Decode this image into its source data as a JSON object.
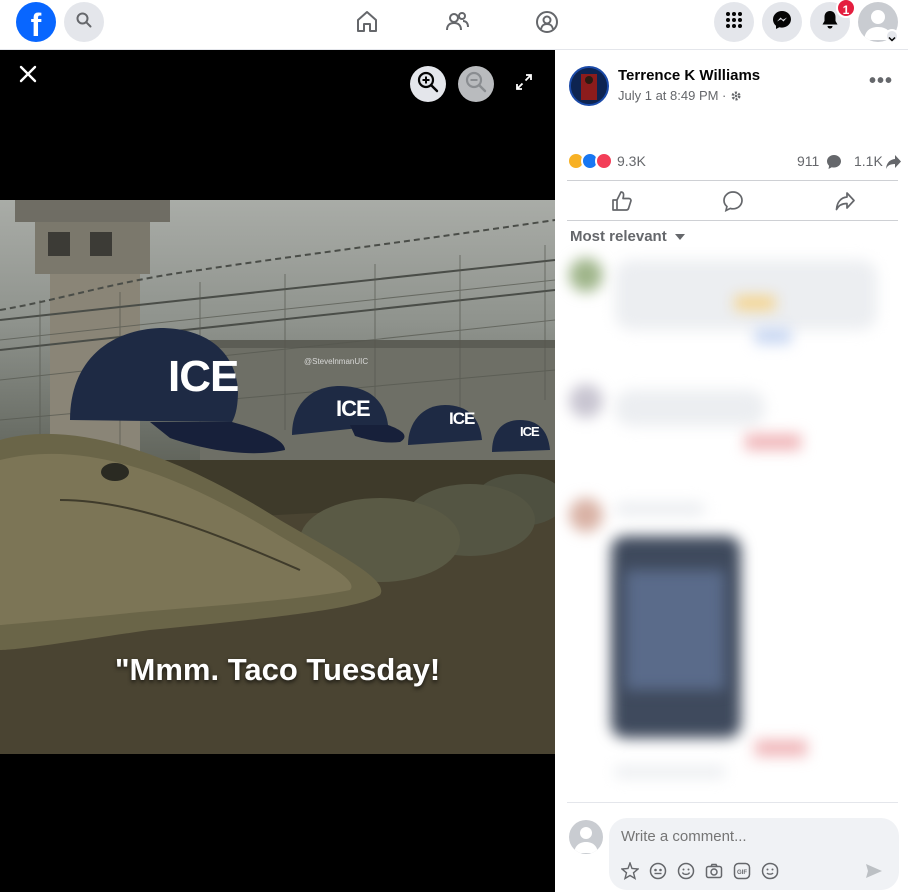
{
  "topbar": {
    "logo": "f",
    "notification_count": "1",
    "icons": [
      "facebook-logo",
      "search-icon",
      "home-icon",
      "friends-icon",
      "groups-icon",
      "menu-grid-icon",
      "messenger-icon",
      "bell-icon",
      "account-avatar"
    ]
  },
  "viewer": {
    "caption": "\"Mmm. Taco Tuesday!",
    "watermark": "@StevelnmanUIC",
    "cap_label": "ICE"
  },
  "post": {
    "author": "Terrence K Williams",
    "time": "July 1 at 8:49 PM ·",
    "reaction_count": "9.3K",
    "comment_count": "911",
    "share_count": "1.1K",
    "sort_label": "Most relevant"
  },
  "composer": {
    "placeholder": "Write a comment..."
  },
  "colors": {
    "brand": "#0866ff",
    "badge": "#e41e3f",
    "viewer_bg": "#000000",
    "muted_text": "#65676b"
  }
}
